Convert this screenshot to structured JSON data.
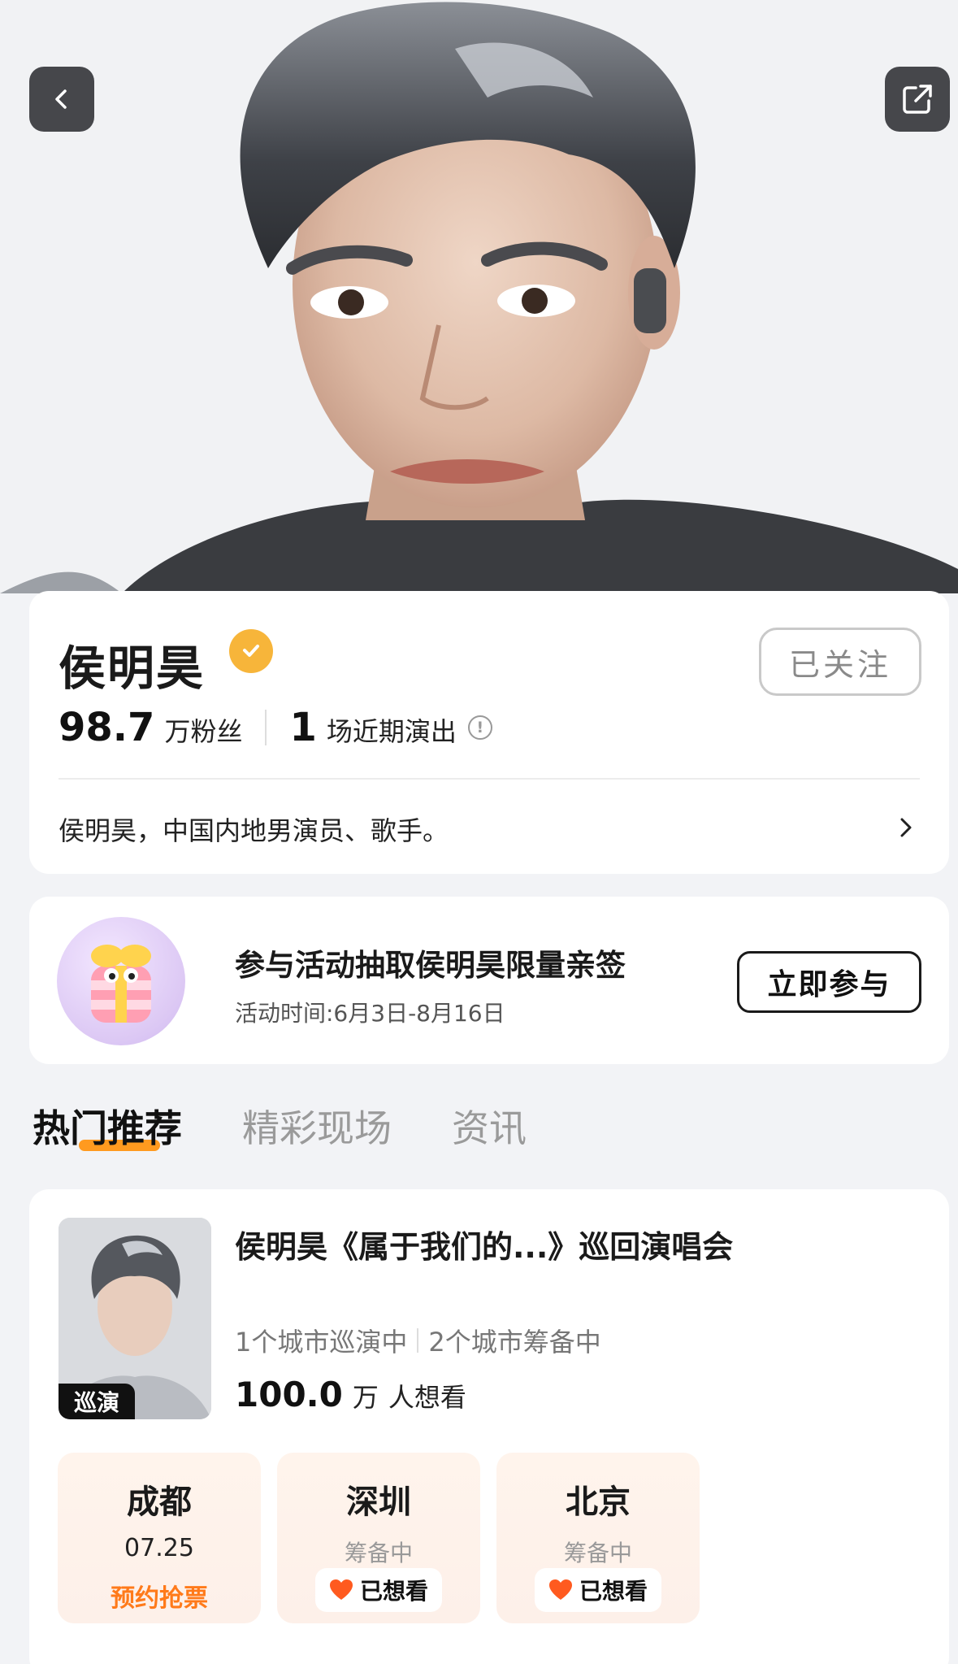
{
  "nav": {
    "back_icon": "chevron-left-icon",
    "share_icon": "share-icon"
  },
  "artist": {
    "name": "侯明昊",
    "verified_color": "#f7b53a",
    "follow_label": "已关注",
    "fans_num": "98.7",
    "fans_label": "万粉丝",
    "shows_num": "1",
    "shows_label": "场近期演出",
    "bio": "侯明昊，中国内地男演员、歌手。"
  },
  "event": {
    "title": "参与活动抽取侯明昊限量亲签",
    "time": "活动时间:6月3日-8月16日",
    "join_label": "立即参与"
  },
  "tabs": [
    {
      "label": "热门推荐",
      "active": true
    },
    {
      "label": "精彩现场",
      "active": false
    },
    {
      "label": "资讯",
      "active": false
    }
  ],
  "tour": {
    "tag": "巡演",
    "title": "侯明昊《属于我们的...》巡回演唱会",
    "touring": "1个城市巡演中",
    "preparing": "2个城市筹备中",
    "want_num": "100.0",
    "want_unit": "万",
    "want_label": "人想看",
    "cities": [
      {
        "name": "成都",
        "date": "07.25",
        "action": "预约抢票"
      },
      {
        "name": "深圳",
        "status": "筹备中",
        "want": "已想看"
      },
      {
        "name": "北京",
        "status": "筹备中",
        "want": "已想看"
      }
    ]
  },
  "colors": {
    "accent": "#ff9a1f",
    "action_orange": "#ff7a1a",
    "heart": "#ff5a1f"
  }
}
